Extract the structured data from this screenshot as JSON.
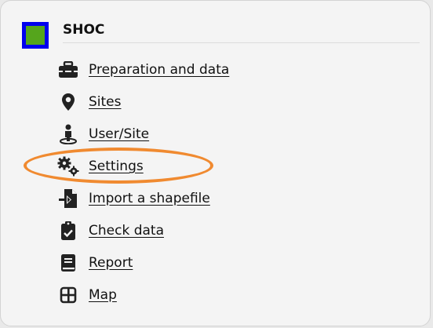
{
  "app": {
    "title": "SHOC",
    "brand_colors": {
      "border": "#0000ee",
      "fill": "#55a51c"
    }
  },
  "menu": {
    "items": [
      {
        "label": "Preparation and data",
        "icon": "toolbox-icon"
      },
      {
        "label": "Sites",
        "icon": "map-marker-icon"
      },
      {
        "label": "User/Site",
        "icon": "person-pin-icon"
      },
      {
        "label": "Settings",
        "icon": "gears-icon"
      },
      {
        "label": "Import a shapefile",
        "icon": "file-import-icon"
      },
      {
        "label": "Check data",
        "icon": "clipboard-check-icon"
      },
      {
        "label": "Report",
        "icon": "book-icon"
      },
      {
        "label": "Map",
        "icon": "grid-icon"
      }
    ]
  },
  "highlight": {
    "target": "Settings",
    "color": "#f08a30"
  }
}
